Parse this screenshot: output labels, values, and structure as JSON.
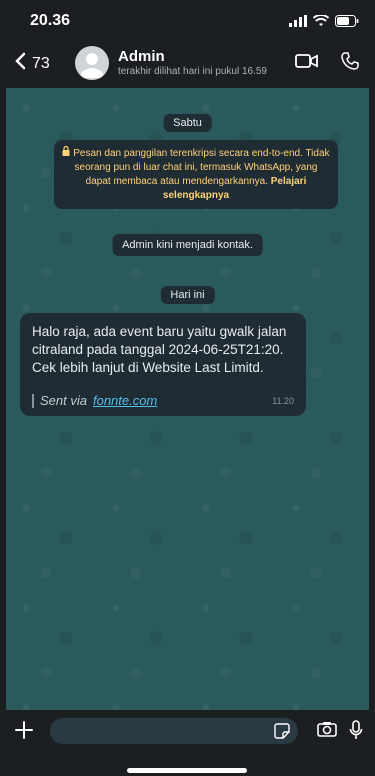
{
  "status": {
    "time": "20.36"
  },
  "header": {
    "back_count": "73",
    "contact_name": "Admin",
    "last_seen": "terakhir dilihat hari ini pukul 16.59"
  },
  "chat": {
    "date_saturday": "Sabtu",
    "encryption_notice": "Pesan dan panggilan terenkripsi secara end-to-end. Tidak seorang pun di luar chat ini, termasuk WhatsApp, yang dapat membaca atau mendengarkannya.",
    "encryption_link": "Pelajari selengkapnya",
    "system_contact": "Admin kini menjadi kontak.",
    "date_today": "Hari ini",
    "message": {
      "text": "Halo raja, ada event baru yaitu gwalk jalan citraland pada tanggal 2024-06-25T21:20. Cek lebih lanjut di Website Last Limitd.",
      "sent_via": "Sent via",
      "sent_link": "fonnte.com",
      "time": "11.20"
    }
  },
  "colors": {
    "chat_bg": "#2a5a5c",
    "bubble": "#1f2c33",
    "notice_text": "#ffd279",
    "link": "#53bdeb"
  }
}
